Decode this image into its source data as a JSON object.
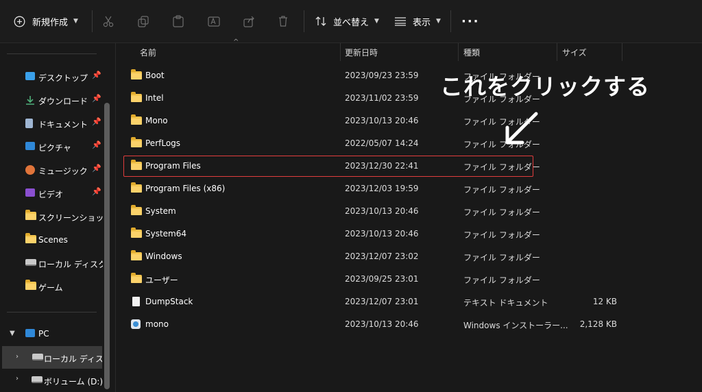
{
  "toolbar": {
    "new_label": "新規作成",
    "sort_label": "並べ替え",
    "view_label": "表示",
    "more_label": "···",
    "icons": [
      "plus-circle-icon",
      "cut-icon",
      "copy-icon",
      "paste-icon",
      "rename-icon",
      "share-icon",
      "delete-icon",
      "sort-icon",
      "view-icon",
      "more-icon"
    ]
  },
  "sidebar": {
    "quick_access": [
      {
        "label": "デスクトップ",
        "icon": "desktop-icon",
        "color": "#3aa0ea",
        "pinned": true
      },
      {
        "label": "ダウンロード",
        "icon": "download-icon",
        "color": "#4fb07a",
        "pinned": true
      },
      {
        "label": "ドキュメント",
        "icon": "document-icon",
        "color": "#9fb6d3",
        "pinned": true
      },
      {
        "label": "ピクチャ",
        "icon": "pictures-icon",
        "color": "#2f88d8",
        "pinned": true
      },
      {
        "label": "ミュージック",
        "icon": "music-icon",
        "color": "#e0743a",
        "pinned": true
      },
      {
        "label": "ビデオ",
        "icon": "video-icon",
        "color": "#8a4fd0",
        "pinned": true
      },
      {
        "label": "スクリーンショット",
        "icon": "folder-icon",
        "color": "#f4c54f",
        "pinned": false
      },
      {
        "label": "Scenes",
        "icon": "folder-icon",
        "color": "#f4c54f",
        "pinned": false
      },
      {
        "label": "ローカル ディスク (C",
        "icon": "drive-icon",
        "color": "#c9c9c9",
        "pinned": false
      },
      {
        "label": "ゲーム",
        "icon": "folder-icon",
        "color": "#f4c54f",
        "pinned": false
      }
    ],
    "pc": {
      "label": "PC"
    },
    "drives": [
      {
        "label": "ローカル ディスク (",
        "selected": true
      },
      {
        "label": "ボリューム (D:)",
        "selected": false
      }
    ]
  },
  "columns": {
    "name": "名前",
    "date": "更新日時",
    "type": "種類",
    "size": "サイズ"
  },
  "files": [
    {
      "name": "Boot",
      "date": "2023/09/23 23:59",
      "type": "ファイル フォルダー",
      "size": "",
      "icon": "folder-icon"
    },
    {
      "name": "Intel",
      "date": "2023/11/02 23:59",
      "type": "ファイル フォルダー",
      "size": "",
      "icon": "folder-icon"
    },
    {
      "name": "Mono",
      "date": "2023/10/13 20:46",
      "type": "ファイル フォルダー",
      "size": "",
      "icon": "folder-icon"
    },
    {
      "name": "PerfLogs",
      "date": "2022/05/07 14:24",
      "type": "ファイル フォルダー",
      "size": "",
      "icon": "folder-icon"
    },
    {
      "name": "Program Files",
      "date": "2023/12/30 22:41",
      "type": "ファイル フォルダー",
      "size": "",
      "icon": "folder-icon"
    },
    {
      "name": "Program Files (x86)",
      "date": "2023/12/03 19:59",
      "type": "ファイル フォルダー",
      "size": "",
      "icon": "folder-icon"
    },
    {
      "name": "System",
      "date": "2023/10/13 20:46",
      "type": "ファイル フォルダー",
      "size": "",
      "icon": "folder-icon"
    },
    {
      "name": "System64",
      "date": "2023/10/13 20:46",
      "type": "ファイル フォルダー",
      "size": "",
      "icon": "folder-icon"
    },
    {
      "name": "Windows",
      "date": "2023/12/07 23:02",
      "type": "ファイル フォルダー",
      "size": "",
      "icon": "folder-icon"
    },
    {
      "name": "ユーザー",
      "date": "2023/09/25 23:01",
      "type": "ファイル フォルダー",
      "size": "",
      "icon": "folder-icon"
    },
    {
      "name": "DumpStack",
      "date": "2023/12/07 23:01",
      "type": "テキスト ドキュメント",
      "size": "12 KB",
      "icon": "text-file-icon"
    },
    {
      "name": "mono",
      "date": "2023/10/13 20:46",
      "type": "Windows インストーラー...",
      "size": "2,128 KB",
      "icon": "installer-icon"
    }
  ],
  "annotation": {
    "text": "これをクリックする",
    "highlight_color": "#e23d3d"
  }
}
